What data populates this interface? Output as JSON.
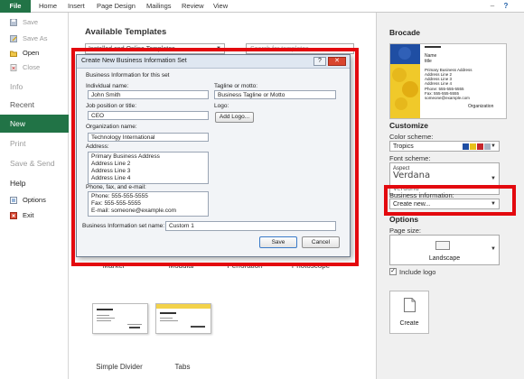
{
  "ribbon": {
    "tabs": [
      "File",
      "Home",
      "Insert",
      "Page Design",
      "Mailings",
      "Review",
      "View"
    ],
    "window_controls": [
      "–",
      "▫",
      "✕"
    ],
    "help": "?"
  },
  "sidebar": {
    "commands": [
      {
        "label": "Save",
        "icon": "save-icon"
      },
      {
        "label": "Save As",
        "icon": "save-as-icon"
      },
      {
        "label": "Open",
        "icon": "open-folder-icon"
      },
      {
        "label": "Close",
        "icon": "close-file-icon"
      }
    ],
    "sections": [
      "Info",
      "Recent",
      "New",
      "Print",
      "Save & Send",
      "Help"
    ],
    "bottom": [
      {
        "label": "Options",
        "icon": "options-icon"
      },
      {
        "label": "Exit",
        "icon": "exit-icon"
      }
    ]
  },
  "templates": {
    "heading": "Available Templates",
    "filter_value": "Installed and Online Templates",
    "search_placeholder": "Search for templates",
    "row_labels": [
      "Marker",
      "Modular",
      "Perforation",
      "Photoscope"
    ],
    "items": [
      {
        "label": "Simple Divider"
      },
      {
        "label": "Tabs"
      }
    ]
  },
  "dialog": {
    "title": "Create New Business Information Set",
    "subtitle": "Business Information for this set",
    "individual_name_label": "Individual name:",
    "individual_name": "John Smith",
    "job_label": "Job position or title:",
    "job": "CEO",
    "org_label": "Organization name:",
    "org": "Technology International",
    "address_label": "Address:",
    "address": [
      "Primary Business Address",
      "Address Line 2",
      "Address Line 3",
      "Address Line 4"
    ],
    "phone_label": "Phone, fax, and e-mail:",
    "phone": [
      "Phone: 555-555-5555",
      "Fax: 555-555-5555",
      "E-mail: someone@example.com"
    ],
    "tagline_label": "Tagline or motto:",
    "tagline": "Business Tagline or Motto",
    "logo_label": "Logo:",
    "add_logo": "Add Logo...",
    "setname_label": "Business Information set name:",
    "setname": "Custom 1",
    "save": "Save",
    "cancel": "Cancel",
    "help_btn": "?",
    "close_btn": "✕"
  },
  "right": {
    "title": "Brocade",
    "preview": {
      "name": "Name",
      "title": "title",
      "addr": "Primary Business Address",
      "lines": [
        "Address Line 2",
        "Address Line 3",
        "Address Line 4"
      ],
      "phone": "Phone: 555-555-5555",
      "fax": "Fax: 555-555-5555",
      "email": "someone@example.com",
      "org": "Organization"
    },
    "customize": "Customize",
    "color_label": "Color scheme:",
    "color_value": "Tropics",
    "color_swatches": [
      "#1f4ea3",
      "#e8c21b",
      "#c4262e",
      "#a8b4c4"
    ],
    "font_label": "Font scheme:",
    "font_aspect": "Aspect",
    "font_main": "Verdana",
    "font_sub": "Verdana",
    "bizinfo_label": "Business information:",
    "bizinfo_value": "Create new...",
    "options": "Options",
    "pagesize_label": "Page size:",
    "pagesize_value": "Landscape",
    "include_logo": "Include logo",
    "include_logo_checked": true,
    "create": "Create"
  }
}
